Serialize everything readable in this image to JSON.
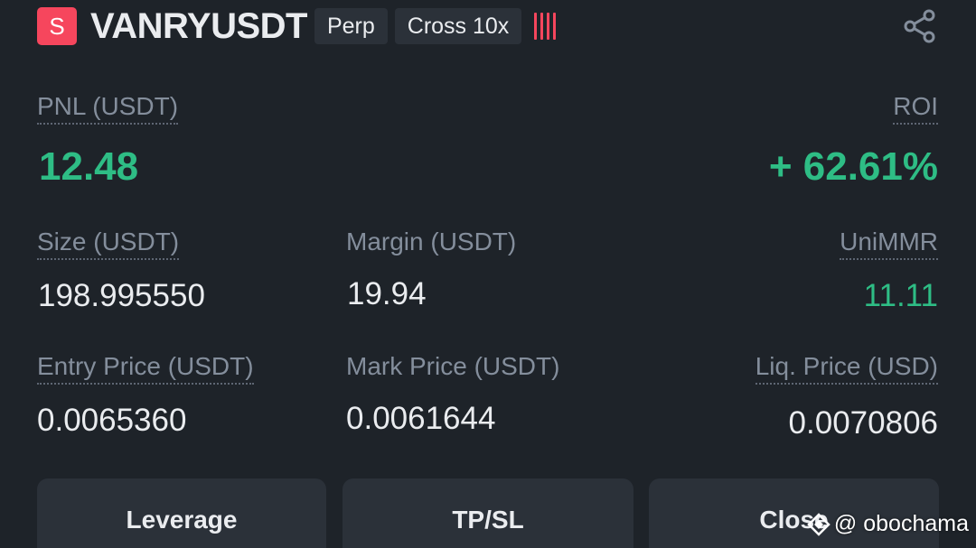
{
  "header": {
    "side_letter": "S",
    "symbol": "VANRYUSDT",
    "contract_type": "Perp",
    "margin_mode": "Cross 10x",
    "risk_level_bars": 4,
    "share_icon": "share-icon"
  },
  "pnl": {
    "label": "PNL (USDT)",
    "value": "12.48"
  },
  "roi": {
    "label": "ROI",
    "value": "+ 62.61%"
  },
  "size": {
    "label": "Size (USDT)",
    "value": "198.995550"
  },
  "margin": {
    "label": "Margin (USDT)",
    "value": "19.94"
  },
  "unimmr": {
    "label": "UniMMR",
    "value": "11.11"
  },
  "entry_price": {
    "label": "Entry Price (USDT)",
    "value": "0.0065360"
  },
  "mark_price": {
    "label": "Mark Price (USDT)",
    "value": "0.0061644"
  },
  "liq_price": {
    "label": "Liq. Price (USD)",
    "value": "0.0070806"
  },
  "buttons": {
    "leverage": "Leverage",
    "tpsl": "TP/SL",
    "close": "Close"
  },
  "watermark": {
    "text": "@ obochama"
  },
  "colors": {
    "short": "#f6465d",
    "profit": "#2ebd85",
    "background": "#1e2329",
    "panel": "#2b3139"
  }
}
